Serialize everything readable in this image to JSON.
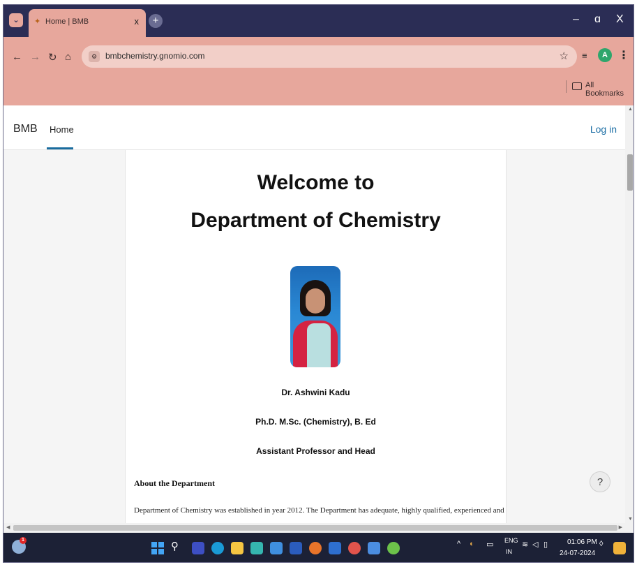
{
  "browser": {
    "tab_title": "Home | BMB",
    "tab_close": "x",
    "new_tab": "+",
    "url": "bmbchemistry.gnomio.com",
    "bookmarks_label": "All Bookmarks",
    "profile_initial": "A",
    "window_controls": {
      "minimize": "–",
      "restore": "ɑ",
      "close": "X"
    },
    "accent_color": "#e7a79c",
    "tabbar_color": "#2b2d55"
  },
  "site": {
    "brand": "BMB",
    "nav_home": "Home",
    "login": "Log in",
    "link_color": "#1d6fa5"
  },
  "content": {
    "heading_line1": "Welcome to",
    "heading_line2": "Department of Chemistry",
    "person_name": "Dr. Ashwini Kadu",
    "qualifications": "Ph.D. M.Sc. (Chemistry), B. Ed",
    "designation": "Assistant Professor and Head",
    "about_title": "About the Department",
    "about_text": "Department of Chemistry was established in year 2012. The Department has adequate, highly qualified, experienced and",
    "help_label": "?"
  },
  "taskbar": {
    "weather_badge": "1",
    "lang_line1": "ENG",
    "lang_line2": "IN",
    "time": "01:06 PM",
    "date": "24-07-2024"
  }
}
